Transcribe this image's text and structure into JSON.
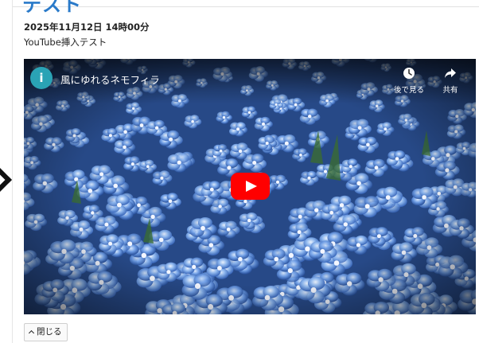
{
  "post": {
    "title": "テスト",
    "date": "2025年11月12日 14時00分",
    "subtitle": "YouTube挿入テスト"
  },
  "video": {
    "channel_initial": "i",
    "title": "風にゆれるネモフィラ",
    "watch_later_label": "後で見る",
    "share_label": "共有",
    "play_icon": "youtube-play-icon",
    "accent_color": "#ff0000"
  },
  "controls": {
    "close_label": "閉じる"
  }
}
